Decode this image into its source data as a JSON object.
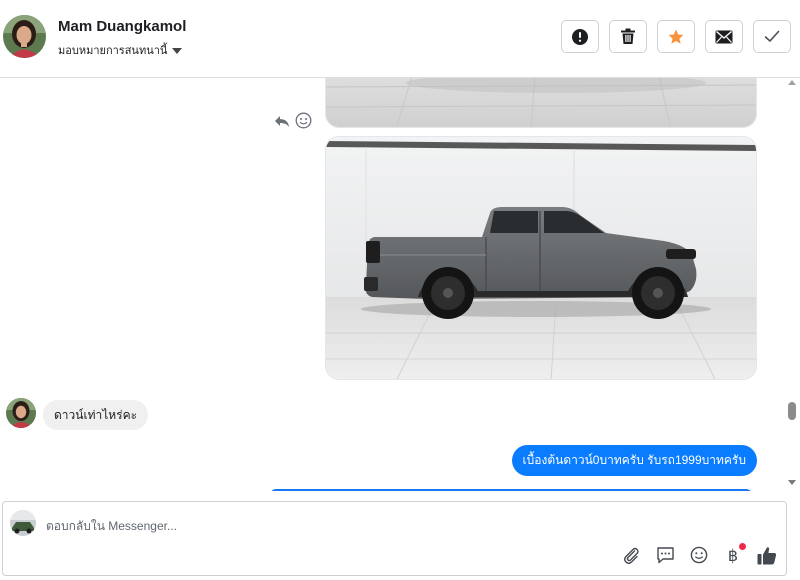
{
  "header": {
    "contact_name": "Mam Duangkamol",
    "assign_label": "มอบหมายการสนทนานี้",
    "actions": [
      {
        "name": "mark-spam-button",
        "icon": "exclamation-circle-icon"
      },
      {
        "name": "delete-button",
        "icon": "trash-icon"
      },
      {
        "name": "star-button",
        "icon": "star-icon",
        "color": "#f7923b"
      },
      {
        "name": "mark-unread-button",
        "icon": "envelope-icon"
      },
      {
        "name": "mark-done-button",
        "icon": "checkmark-icon"
      }
    ]
  },
  "conversation": {
    "messages": [
      {
        "type": "image",
        "direction": "outgoing",
        "content": "showroom-floor-photo"
      },
      {
        "type": "image",
        "direction": "outgoing",
        "content": "grey-pickup-truck-photo"
      },
      {
        "type": "text",
        "direction": "incoming",
        "text": "ดาวน์เท่าไหร่คะ"
      },
      {
        "type": "text",
        "direction": "outgoing",
        "text": "เบื้องต้นดาวน์0บาทครับ รับรถ1999บาทครับ"
      }
    ],
    "message_tools": [
      "reply-icon",
      "emoji-reaction-icon"
    ]
  },
  "composer": {
    "placeholder": "ตอบกลับใน Messenger...",
    "tools": [
      "paperclip-icon",
      "saved-replies-icon",
      "emoji-icon",
      "baht-payment-icon",
      "thumbs-up-icon"
    ],
    "baht_symbol": "฿",
    "notification_dot_color": "#f02849"
  },
  "colors": {
    "accent": "#0a7cff",
    "incoming_bubble": "#f0f0f0",
    "border": "#ccd0d5"
  }
}
